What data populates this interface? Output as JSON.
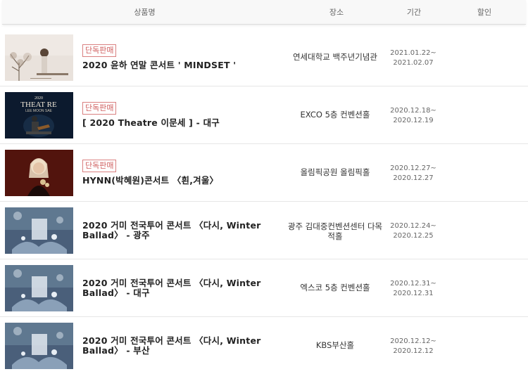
{
  "header": {
    "product": "상품명",
    "venue": "장소",
    "period": "기간",
    "discount": "할인"
  },
  "items": [
    {
      "badge": "단독판매",
      "title": "2020 윤하 연말 콘서트 ' MINDSET '",
      "venue": "연세대학교 백주년기념관",
      "period_start": "2021.01.22~",
      "period_end": "2021.02.07",
      "poster_text": []
    },
    {
      "badge": "단독판매",
      "title": "[ 2020 Theatre 이문세 ] - 대구",
      "venue": "EXCO 5층 컨벤션홀",
      "period_start": "2020.12.18~",
      "period_end": "2020.12.19",
      "poster_text": [
        "2020",
        "THEAT RE",
        "LEE MOON SAE"
      ]
    },
    {
      "badge": "단독판매",
      "title": "HYNN(박혜원)콘서트 〈흰,겨울〉",
      "venue": "올림픽공원 올림픽홀",
      "period_start": "2020.12.27~",
      "period_end": "2020.12.27",
      "poster_text": []
    },
    {
      "badge": "",
      "title_line1": "2020 거미 전국투어 콘서트 〈다시, Winter",
      "title_line2": "Ballad〉 - 광주",
      "venue_line1": "광주 김대중컨벤션센터 다목",
      "venue_line2": "적홀",
      "period_start": "2020.12.24~",
      "period_end": "2020.12.25",
      "poster_text": []
    },
    {
      "badge": "",
      "title_line1": "2020 거미 전국투어 콘서트 〈다시, Winter",
      "title_line2": "Ballad〉 - 대구",
      "venue": "엑스코 5층 컨벤션홀",
      "period_start": "2020.12.31~",
      "period_end": "2020.12.31",
      "poster_text": []
    },
    {
      "badge": "",
      "title_line1": "2020 거미 전국투어 콘서트 〈다시, Winter",
      "title_line2": "Ballad〉 - 부산",
      "venue": "KBS부산홀",
      "period_start": "2020.12.12~",
      "period_end": "2020.12.12",
      "poster_text": []
    }
  ],
  "colors": {
    "badge": "#d06060",
    "header_bg": "#f8f8f8",
    "divider": "#e6e6e6"
  }
}
